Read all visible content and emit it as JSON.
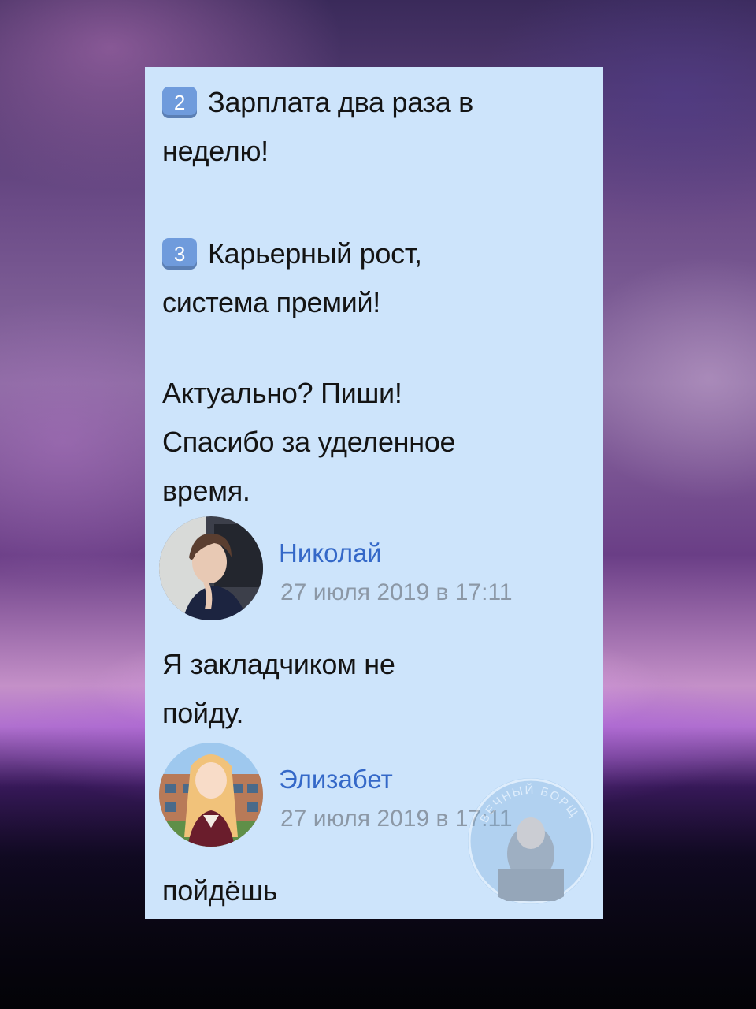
{
  "post": {
    "point2_marker": "2",
    "point2_line1": "Зарплата два раза в",
    "point2_line2": "неделю!",
    "point3_marker": "3",
    "point3_line1": "Карьерный рост,",
    "point3_line2": "система премий!",
    "cta_line1": "Актуально? Пиши!",
    "cta_line2": "Спасибо за уделенное",
    "cta_line3": "время."
  },
  "comments": [
    {
      "author": "Николай",
      "date": "27 июля 2019 в 17:11",
      "text_line1": "Я закладчиком не",
      "text_line2": "пойду.",
      "avatar_icon": "anime-boy-avatar"
    },
    {
      "author": "Элизабет",
      "date": "27 июля 2019 в 17:11",
      "text_line1": "пойдёшь",
      "avatar_icon": "anime-girl-avatar"
    }
  ],
  "watermark": {
    "text": "ВЕЧНЫЙ БОРЩ"
  },
  "colors": {
    "panel_bg": "#cde4fb",
    "author_link": "#3468c8",
    "date_gray": "#8c98a6",
    "keycap": "#6f9bdc"
  }
}
